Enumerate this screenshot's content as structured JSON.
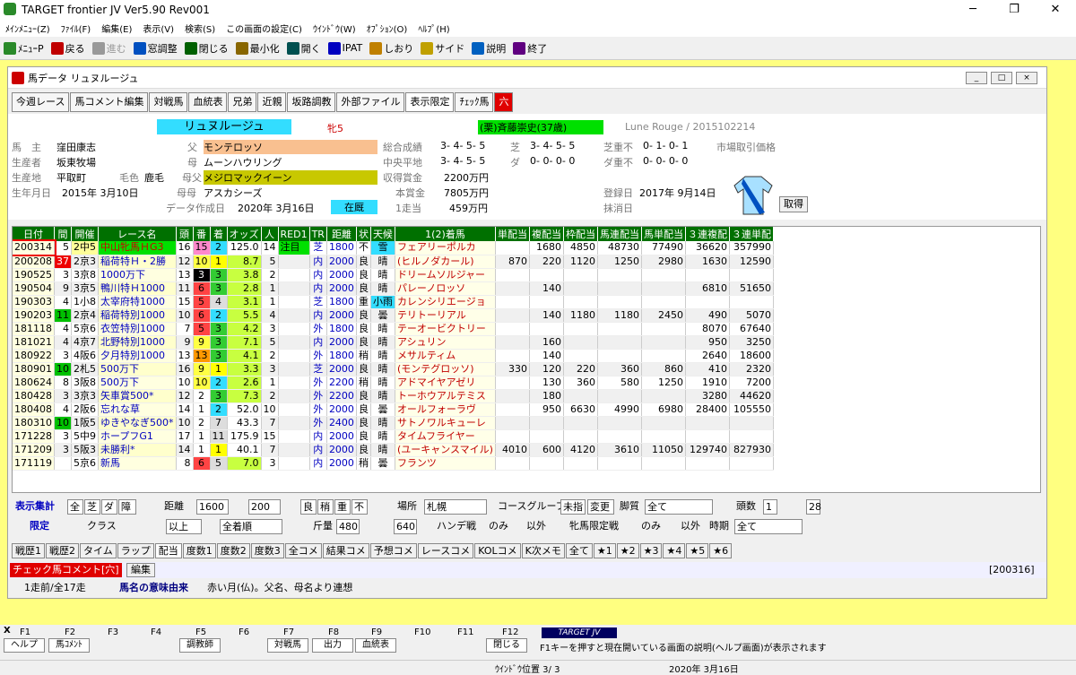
{
  "app": {
    "title": "TARGET frontier JV  Ver5.90  Rev001"
  },
  "menu": [
    "ﾒｲﾝﾒﾆｭｰ(Z)",
    "ﾌｧｲﾙ(F)",
    "編集(E)",
    "表示(V)",
    "検索(S)",
    "この画面の設定(C)",
    "ｳｲﾝﾄﾞｳ(W)",
    "ｵﾌﾟｼｮﾝ(O)",
    "ﾍﾙﾌﾟ(H)"
  ],
  "toolbar": [
    "ﾒﾆｭｰP",
    "戻る",
    "進む",
    "窓調整",
    "閉じる",
    "最小化",
    "開く",
    "IPAT",
    "しおり",
    "サイド",
    "説明",
    "終了"
  ],
  "window": {
    "title": "馬データ リュヌルージュ"
  },
  "tabs": [
    "今週レース",
    "馬コメント編集",
    "対戦馬",
    "血統表",
    "兄弟",
    "近親",
    "坂路調教",
    "外部ファイル",
    "表示限定",
    "ﾁｪｯｸ馬",
    "六"
  ],
  "horse": {
    "name": "リュヌルージュ",
    "sexage": "牝5",
    "trainer": "(栗)斉藤崇史(37歳)",
    "romaji": "Lune Rouge / 2015102214",
    "owner_l": "馬　主",
    "owner": "窪田康志",
    "breeder_l": "生産者",
    "breeder": "坂東牧場",
    "origin_l": "生産地",
    "origin": "平取町",
    "color_l": "毛色",
    "color": "鹿毛",
    "born_l": "生年月日",
    "born": "2015年 3月10日",
    "sire_l": "父",
    "sire": "モンテロッソ",
    "dam_l": "母",
    "dam": "ムーンハウリング",
    "bms_l": "母父",
    "bms": "メジロマックイーン",
    "dam2_l": "母母",
    "dam2": "アスカシーズ",
    "created_l": "データ作成日",
    "created": "2020年 3月16日",
    "status": "在厩",
    "total_l": "総合成績",
    "total": "3- 4- 5- 5",
    "chuo_l": "中央平地",
    "chuo": "3- 4- 5- 5",
    "prize_l": "収得賞金",
    "prize": "2200万円",
    "honsho_l": "本賞金",
    "honsho": "7805万円",
    "per_l": "1走当",
    "per": "459万円",
    "turf_l": "芝",
    "turf": "3- 4- 5- 5",
    "dirt_l": "ダ",
    "dirt": "0- 0- 0- 0",
    "turfbad_l": "芝重不",
    "turfbad": "0- 1- 0- 1",
    "dirtbad_l": "ダ重不",
    "dirtbad": "0- 0- 0- 0",
    "market": "市場取引価格",
    "reg_l": "登録日",
    "reg": "2017年 9月14日",
    "del_l": "抹消日",
    "cancel": "取得"
  },
  "columns": [
    "日付",
    "間",
    "開催",
    "レース名",
    "頭",
    "番",
    "着",
    "オッズ",
    "人",
    "RED1",
    "TR",
    "距離",
    "状",
    "天候",
    "1(2)着馬",
    "単配当",
    "複配当",
    "枠配当",
    "馬連配当",
    "馬単配当",
    "３連複配",
    "３連単配"
  ],
  "rows": [
    [
      "200314",
      "5",
      "2中5",
      "中山牝馬ＨG3",
      "16",
      "15",
      "2",
      "125.0",
      "14",
      "注目",
      "芝",
      "1800",
      "不",
      "雪",
      "フェアリーポルカ",
      "",
      "1680",
      "4850",
      "48730",
      "77490",
      "36620",
      "357990"
    ],
    [
      "200208",
      "37",
      "2京3",
      "稲荷特Ｈ・2勝",
      "12",
      "10",
      "1",
      "8.7",
      "5",
      "",
      "内",
      "2000",
      "良",
      "晴",
      "(ヒルノダカール)",
      "870",
      "220",
      "1120",
      "1250",
      "2980",
      "1630",
      "12590"
    ],
    [
      "190525",
      "3",
      "3京8",
      "1000万下",
      "13",
      "3",
      "3",
      "3.8",
      "2",
      "",
      "内",
      "2000",
      "良",
      "晴",
      "ドリームソルジャー",
      "",
      "",
      "",
      "",
      "",
      "",
      ""
    ],
    [
      "190504",
      "9",
      "3京5",
      "鴨川特Ｈ1000",
      "11",
      "6",
      "3",
      "2.8",
      "1",
      "",
      "内",
      "2000",
      "良",
      "晴",
      "パレーノロッソ",
      "",
      "140",
      "",
      "",
      "",
      "6810",
      "51650"
    ],
    [
      "190303",
      "4",
      "1小8",
      "太宰府特1000",
      "15",
      "5",
      "4",
      "3.1",
      "1",
      "",
      "芝",
      "1800",
      "重",
      "小雨",
      "カレンシリエージョ",
      "",
      "",
      "",
      "",
      "",
      "",
      ""
    ],
    [
      "190203",
      "11",
      "2京4",
      "稲荷特別1000",
      "10",
      "6",
      "2",
      "5.5",
      "4",
      "",
      "内",
      "2000",
      "良",
      "曇",
      "テリトーリアル",
      "",
      "140",
      "1180",
      "1180",
      "2450",
      "490",
      "5070"
    ],
    [
      "181118",
      "4",
      "5京6",
      "衣笠特別1000",
      "7",
      "5",
      "3",
      "4.2",
      "3",
      "",
      "外",
      "1800",
      "良",
      "晴",
      "テーオービクトリー",
      "",
      "",
      "",
      "",
      "",
      "8070",
      "67640"
    ],
    [
      "181021",
      "4",
      "4京7",
      "北野特別1000",
      "9",
      "9",
      "3",
      "7.1",
      "5",
      "",
      "内",
      "2000",
      "良",
      "晴",
      "アシュリン",
      "",
      "160",
      "",
      "",
      "",
      "950",
      "3250"
    ],
    [
      "180922",
      "3",
      "4阪6",
      "夕月特別1000",
      "13",
      "13",
      "3",
      "4.1",
      "2",
      "",
      "外",
      "1800",
      "稍",
      "晴",
      "メサルティム",
      "",
      "140",
      "",
      "",
      "",
      "2640",
      "18600"
    ],
    [
      "180901",
      "10",
      "2札5",
      "500万下",
      "16",
      "9",
      "1",
      "3.3",
      "3",
      "",
      "芝",
      "2000",
      "良",
      "晴",
      "(モンテグロッソ)",
      "330",
      "120",
      "220",
      "360",
      "860",
      "410",
      "2320"
    ],
    [
      "180624",
      "8",
      "3阪8",
      "500万下",
      "10",
      "10",
      "2",
      "2.6",
      "1",
      "",
      "外",
      "2200",
      "稍",
      "晴",
      "アドマイヤアゼリ",
      "",
      "130",
      "360",
      "580",
      "1250",
      "1910",
      "7200"
    ],
    [
      "180428",
      "3",
      "3京3",
      "矢車賞500*",
      "12",
      "2",
      "3",
      "7.3",
      "2",
      "",
      "外",
      "2200",
      "良",
      "晴",
      "トーホウアルテミス",
      "",
      "180",
      "",
      "",
      "",
      "3280",
      "44620"
    ],
    [
      "180408",
      "4",
      "2阪6",
      "忘れな草",
      "14",
      "1",
      "2",
      "52.0",
      "10",
      "",
      "外",
      "2000",
      "良",
      "曇",
      "オールフォーラヴ",
      "",
      "950",
      "6630",
      "4990",
      "6980",
      "28400",
      "105550"
    ],
    [
      "180310",
      "10",
      "1阪5",
      "ゆきやなぎ500*",
      "10",
      "2",
      "7",
      "43.3",
      "7",
      "",
      "外",
      "2400",
      "良",
      "晴",
      "サトノワルキューレ",
      "",
      "",
      "",
      "",
      "",
      "",
      ""
    ],
    [
      "171228",
      "3",
      "5中9",
      "ホープフG1",
      "17",
      "1",
      "11",
      "175.9",
      "15",
      "",
      "内",
      "2000",
      "良",
      "晴",
      "タイムフライヤー",
      "",
      "",
      "",
      "",
      "",
      "",
      ""
    ],
    [
      "171209",
      "3",
      "5阪3",
      "未勝利*",
      "14",
      "1",
      "1",
      "40.1",
      "7",
      "",
      "内",
      "2000",
      "良",
      "晴",
      "(ユーキャンスマイル)",
      "4010",
      "600",
      "4120",
      "3610",
      "11050",
      "129740",
      "827930"
    ],
    [
      "171119",
      "",
      "5京6",
      "新馬",
      "8",
      "6",
      "5",
      "7.0",
      "3",
      "",
      "内",
      "2000",
      "稍",
      "曇",
      "フランツ",
      "",
      "",
      "",
      "",
      "",
      "",
      ""
    ]
  ],
  "filters": {
    "hyoji": "表示集計",
    "zen": "全",
    "shiba": "芝",
    "da": "ダ",
    "sho": "障",
    "kyori": "距離",
    "k1": "1600",
    "k2": "200",
    "ryo": "良",
    "yaya": "稍",
    "omo": "重",
    "fu": "不",
    "basho": "場所",
    "place": "札幌",
    "course": "コースグループ",
    "mi": "未指",
    "henko": "変更",
    "kyakushitsu": "脚質",
    "all": "全て",
    "tosu": "頭数",
    "t1": "1",
    "t2": "28",
    "gentei": "限定",
    "class": "クラス",
    "ijo": "以上",
    "chakujun": "全着順",
    "kinryo": "斤量",
    "w1": "480",
    "w2": "640",
    "handi": "ハンデ戦",
    "nomi": "のみ",
    "igai": "以外",
    "hinba": "牝馬限定戦",
    "nomi2": "のみ",
    "igai2": "以外",
    "jiki": "時期",
    "all2": "全て"
  },
  "bottomtabs": [
    "戦歴1",
    "戦歴2",
    "タイム",
    "ラップ",
    "配当",
    "度数1",
    "度数2",
    "度数3",
    "全コメ",
    "結果コメ",
    "予想コメ",
    "レースコメ",
    "KOLコメ",
    "K次メモ",
    "全て",
    "★1",
    "★2",
    "★3",
    "★4",
    "★5",
    "★6"
  ],
  "comment": {
    "label": "チェック馬コメント[穴]",
    "edit": "編集",
    "code": "[200316]",
    "prev": "1走前/全17走",
    "meaning_l": "馬名の意味由来",
    "meaning": "赤い月(仏)。父名、母名より連想"
  },
  "fkeys": [
    "F1",
    "F2",
    "F3",
    "F4",
    "F5",
    "F6",
    "F7",
    "F8",
    "F9",
    "F10",
    "F11",
    "F12"
  ],
  "fkeylabels": [
    "ヘルプ",
    "馬ｺﾒﾝﾄ",
    "",
    "",
    "調教師",
    "",
    "対戦馬",
    "出力",
    "血統表",
    "",
    "",
    "閉じる"
  ],
  "fhelp": "F1キーを押すと現在開いている画面の説明(ヘルプ画面)が表示されます",
  "brand": "TARGET JV",
  "status": {
    "window": "ｳｲﾝﾄﾞｳ位置 3/ 3",
    "date": "2020年 3月16日"
  }
}
